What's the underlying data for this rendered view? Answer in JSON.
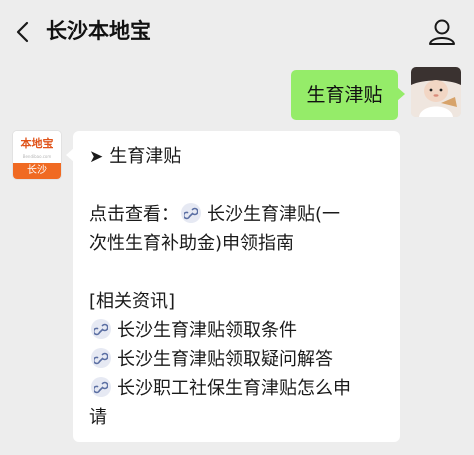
{
  "header": {
    "title": "长沙本地宝"
  },
  "messages": {
    "outgoing_text": "生育津贴",
    "incoming": {
      "sender_brand": "本地宝",
      "sender_brand_url": "Bendibao.com",
      "sender_city": "长沙",
      "heading_arrow": "➤",
      "heading": "生育津贴",
      "view_prefix": "点击查看：",
      "main_link_line1": "长沙生育津贴(一",
      "main_link_line2": "次性生育补助金)申领指南",
      "related_title": "[相关资讯]",
      "related_links": [
        "长沙生育津贴领取条件",
        "长沙生育津贴领取疑问解答",
        "长沙职工社保生育津贴怎么申",
        "请"
      ]
    }
  },
  "colors": {
    "background": "#ededed",
    "outgoing_bubble": "#95ec69",
    "incoming_bubble": "#ffffff",
    "brand_orange": "#f06a22"
  },
  "icons": {
    "back": "chevron-left-icon",
    "profile": "user-icon",
    "link": "mini-program-link-icon"
  }
}
